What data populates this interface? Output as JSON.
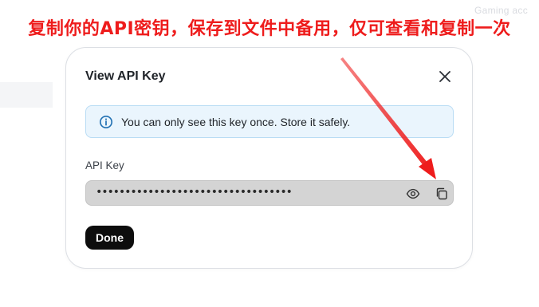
{
  "annotation": {
    "text": "复制你的API密钥，保存到文件中备用，仅可查看和复制一次",
    "color": "#ee1c1c"
  },
  "background": {
    "top_right_text": "Gaming acc"
  },
  "modal": {
    "title": "View API Key",
    "close_icon": "close-icon",
    "info": {
      "icon": "info-icon",
      "text": "You can only see this key once. Store it safely."
    },
    "field": {
      "label": "API Key",
      "value": "••••••••••••••••••••••••••••••••••",
      "reveal_icon": "eye-icon",
      "copy_icon": "copy-icon"
    },
    "done_label": "Done"
  },
  "colors": {
    "accent_info_bg": "#eaf5fd",
    "accent_info_border": "#b9dcf4",
    "primary_button": "#0d0d0d",
    "arrow": "#ee1c1c"
  }
}
